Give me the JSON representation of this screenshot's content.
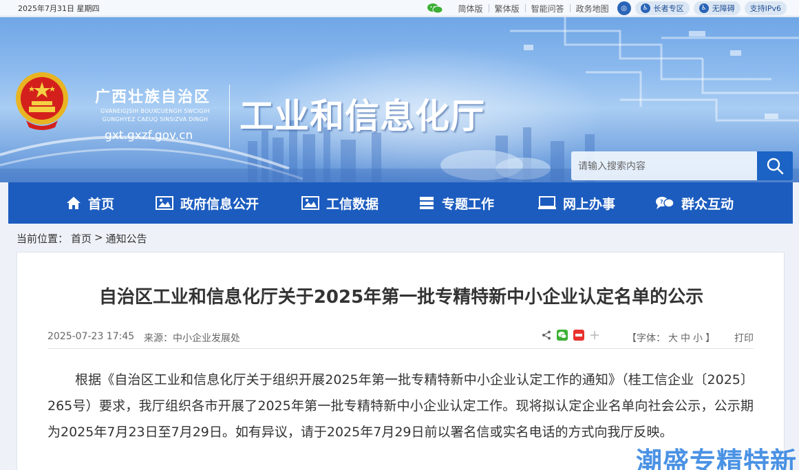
{
  "topbar": {
    "date": "2025年7月31日  星期四",
    "links": [
      "简体版",
      "繁体版",
      "智能问答",
      "政务地图"
    ],
    "elder_zone": "长者专区",
    "accessible": "无障碍",
    "ipv6": "支持IPv6"
  },
  "header": {
    "region_name": "广西壮族自治区",
    "region_name_zhuang": "GVANEIGJSIH BOUXCUENGH SWCIGIH GUNGHYEZ CAEUQ SINSIZVA DINGH",
    "domain": "gxt.gxzf.gov.cn",
    "site_name": "工业和信息化厅",
    "search_placeholder": "请输入搜索内容"
  },
  "nav": {
    "items": [
      {
        "label": "首页",
        "icon": "home-icon"
      },
      {
        "label": "政府信息公开",
        "icon": "picture-icon"
      },
      {
        "label": "工信数据",
        "icon": "picture-icon"
      },
      {
        "label": "专题工作",
        "icon": "stack-icon"
      },
      {
        "label": "网上办事",
        "icon": "monitor-icon"
      },
      {
        "label": "群众互动",
        "icon": "chat-icon"
      }
    ]
  },
  "breadcrumb": {
    "prefix": "当前位置：",
    "home": "首页",
    "sep": ">",
    "current": "通知公告"
  },
  "article": {
    "title": "自治区工业和信息化厅关于2025年第一批专精特新中小企业认定名单的公示",
    "published": "2025-07-23 17:45",
    "source": "来源：中小企业发展处",
    "font_label": "【字体：",
    "font_sizes": [
      "大",
      "中",
      "小"
    ],
    "font_close": "】",
    "print": "打印",
    "body": "根据《自治区工业和信息化厅关于组织开展2025年第一批专精特新中小企业认定工作的通知》（桂工信企业〔2025〕265号）要求，我厅组织各市开展了2025年第一批专精特新中小企业认定工作。现将拟认定企业名单向社会公示，公示期为2025年7月23日至7月29日。如有异议，请于2025年7月29日前以署名信或实名电话的方式向我厅反映。"
  },
  "watermark": "潮盛专精特新",
  "colors": {
    "nav_blue": "#1c5cbf",
    "search_button": "#1b63c4"
  }
}
